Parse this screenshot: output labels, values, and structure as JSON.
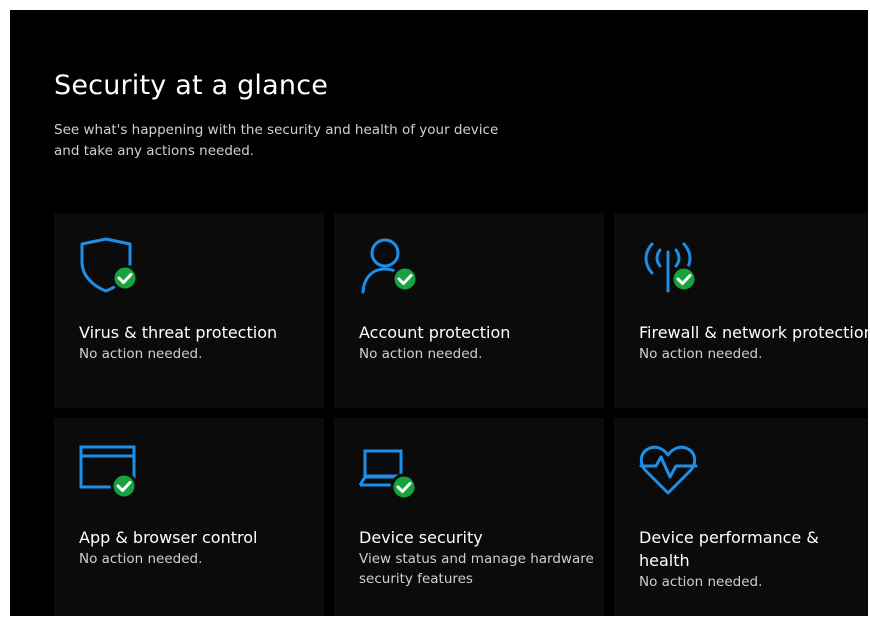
{
  "page": {
    "title": "Security at a glance",
    "subtitle": "See what's happening with the security and health of your device and take any actions needed."
  },
  "colors": {
    "accent": "#1e8fe8",
    "ok": "#15a33d",
    "background": "#000000",
    "tile": "#0b0b0b"
  },
  "tiles": [
    {
      "title": "Virus & threat protection",
      "status": "No action needed.",
      "icon": "shield-icon",
      "badge": "check"
    },
    {
      "title": "Account protection",
      "status": "No action needed.",
      "icon": "person-icon",
      "badge": "check"
    },
    {
      "title": "Firewall & network protection",
      "status": "No action needed.",
      "icon": "antenna-icon",
      "badge": "check"
    },
    {
      "title": "App & browser control",
      "status": "No action needed.",
      "icon": "browser-window-icon",
      "badge": "check"
    },
    {
      "title": "Device security",
      "status": "View status and manage hardware security features",
      "icon": "laptop-icon",
      "badge": "check"
    },
    {
      "title": "Device performance & health",
      "status": "No action needed.",
      "icon": "heart-pulse-icon",
      "badge": "none"
    }
  ]
}
